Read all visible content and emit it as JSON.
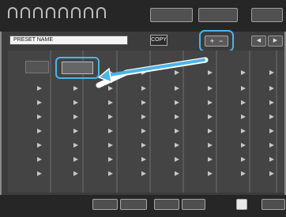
{
  "top_bar": {
    "buttons": [
      "",
      "",
      ""
    ]
  },
  "name_field": {
    "value": "PRESET NAME"
  },
  "copy_button": {
    "label": "COPY"
  },
  "plus_minus": {
    "plus": "+",
    "minus": "−"
  },
  "nav": {
    "left": "◀",
    "right": "▶"
  },
  "row_label": "",
  "selected_cell": {
    "label": ""
  },
  "status": {
    "text": ""
  },
  "bottom_buttons": [
    "",
    "",
    "",
    "",
    "",
    ""
  ],
  "colors": {
    "accent": "#49b5e9",
    "panel": "#3c3c3c",
    "strip": "#262626"
  }
}
